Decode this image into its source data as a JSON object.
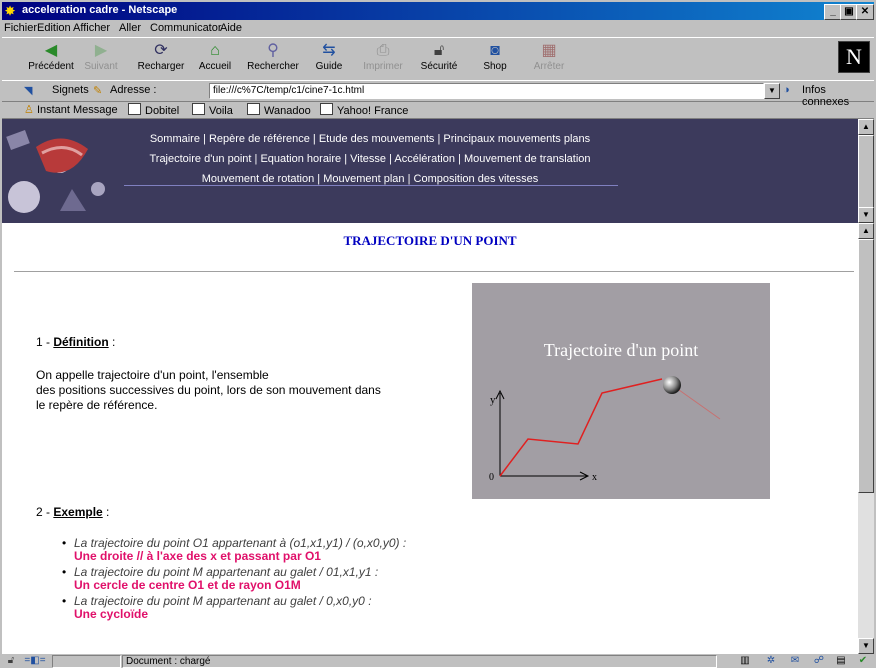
{
  "window": {
    "title": "acceleration cadre - Netscape"
  },
  "menu": [
    "Fichier",
    "Edition",
    "Afficher",
    "Aller",
    "Communicator",
    "Aide"
  ],
  "toolbar": {
    "buttons": [
      {
        "label": "Précédent",
        "icon": "back-arrow-icon"
      },
      {
        "label": "Suivant",
        "icon": "forward-arrow-icon"
      },
      {
        "label": "Recharger",
        "icon": "reload-icon"
      },
      {
        "label": "Accueil",
        "icon": "home-icon"
      },
      {
        "label": "Rechercher",
        "icon": "search-icon"
      },
      {
        "label": "Guide",
        "icon": "guide-icon"
      },
      {
        "label": "Imprimer",
        "icon": "print-icon"
      },
      {
        "label": "Sécurité",
        "icon": "lock-icon"
      },
      {
        "label": "Shop",
        "icon": "shop-icon"
      },
      {
        "label": "Arrêter",
        "icon": "stop-icon"
      }
    ]
  },
  "location": {
    "bookmarks_label": "Signets",
    "address_label": "Adresse :",
    "url": "file:///c%7C/temp/c1/cine7-1c.html",
    "related_label": "Infos connexes"
  },
  "personal_bar": [
    "Instant Message",
    "Dobitel",
    "Voila",
    "Wanadoo",
    "Yahoo! France"
  ],
  "nav": {
    "line1": [
      "Sommaire",
      "Repère de référence",
      "Etude des mouvements",
      "Principaux mouvements plans"
    ],
    "line2": [
      "Trajectoire d'un point",
      "Equation horaire",
      "Vitesse",
      "Accélération",
      "Mouvement de translation"
    ],
    "line3": [
      "Mouvement de rotation",
      "Mouvement plan",
      "Composition des vitesses"
    ],
    "separator": " | "
  },
  "page": {
    "title": "TRAJECTOIRE D'UN POINT",
    "section1_num": "1 - ",
    "section1_title": "Définition",
    "section1_suffix": " :",
    "definition_line1": "On appelle trajectoire d'un point, l'ensemble",
    "definition_line2": "des positions successives du point, lors de son mouvement dans",
    "definition_line3": "le repère de référence.",
    "figure": {
      "title": "Trajectoire d'un point",
      "axis_y": "y",
      "axis_x": "x",
      "origin": "0"
    },
    "section2_num": "2 - ",
    "section2_title": "Exemple",
    "section2_suffix": " :",
    "examples": [
      {
        "text": "La trajectoire du point O1 appartenant à (o1,x1,y1) / (o,x0,y0) :",
        "answer": "Une droite // à l'axe des x et passant par O1"
      },
      {
        "text": "La trajectoire du point M appartenant au galet / 01,x1,y1 :",
        "answer": "Un cercle de centre O1 et de rayon O1M"
      },
      {
        "text": "La trajectoire du point M appartenant au galet / 0,x0,y0 :",
        "answer": "Une cycloïde"
      }
    ]
  },
  "status": {
    "text": "Document : chargé"
  },
  "colors": {
    "title_blue": "#0000c0",
    "answer_pink": "#e0106a",
    "banner": "#3c3a5c",
    "figure_bg": "#a29ea4",
    "trajectory_red": "#e02020"
  }
}
